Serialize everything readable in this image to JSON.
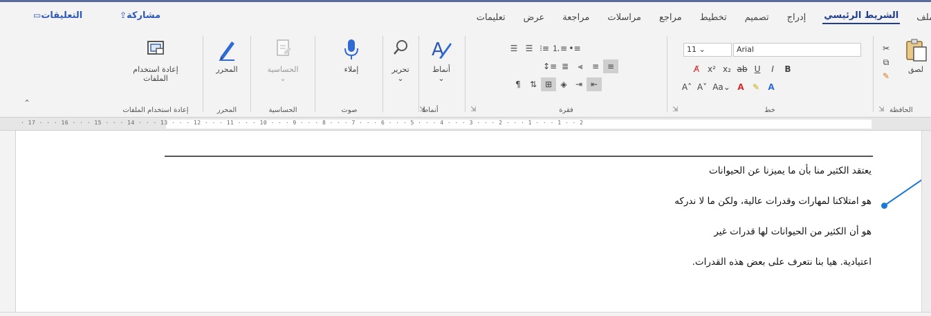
{
  "tabs": {
    "file": "ملف",
    "home": "الشريط الرئيسي",
    "insert": "إدراج",
    "design": "تصميم",
    "layout": "تخطيط",
    "references": "مراجع",
    "mailings": "مراسلات",
    "review": "مراجعة",
    "view": "عرض",
    "help": "تعليمات",
    "share": "مشاركة",
    "comments": "التعليقات"
  },
  "ribbon": {
    "groups": {
      "clipboard": "الحافظة",
      "font": "خط",
      "paragraph": "فقرة",
      "styles": "أنماط",
      "voice": "صوت",
      "sensitivity": "الحساسية",
      "editor": "المحرر",
      "reuse": "إعادة استخدام الملفات"
    },
    "buttons": {
      "paste": "لصق",
      "styles": "أنماط",
      "editing": "تحرير",
      "dictate": "إملاء",
      "sensitivity": "الحساسية",
      "editor": "المحرر",
      "reuse_line1": "إعادة استخدام",
      "reuse_line2": "الملفات"
    },
    "font": {
      "name": "Arial",
      "size": "11"
    }
  },
  "ruler": {
    "numbers": "· 17 · · · 16 · · · 15 · · · 14 · · · 13 · · · 12 · · · 11 · · · 10 · · · 9 · · · 8 · · · 7 · · · 6 · · · 5 · · · 4 · · · 3 · · · 2 · · · 1 · · · 1 · · 2"
  },
  "document": {
    "lines": [
      "يعتقد الكثير منا بأن ما يميزنا عن الحيوانات",
      "هو امتلاكنا لمهارات وقدرات عالية، ولكن ما لا ندركه",
      "هو أن الكثير من الحيوانات لها قدرات غير",
      "اعتيادية. هيا بنا نتعرف على بعض هذه القدرات."
    ]
  },
  "colors": {
    "accent": "#1f3d8a",
    "share": "#2f58b6",
    "pointer": "#1a78d6",
    "highlight_yellow": "#f2e13a",
    "font_color_red": "#d62a2a"
  }
}
